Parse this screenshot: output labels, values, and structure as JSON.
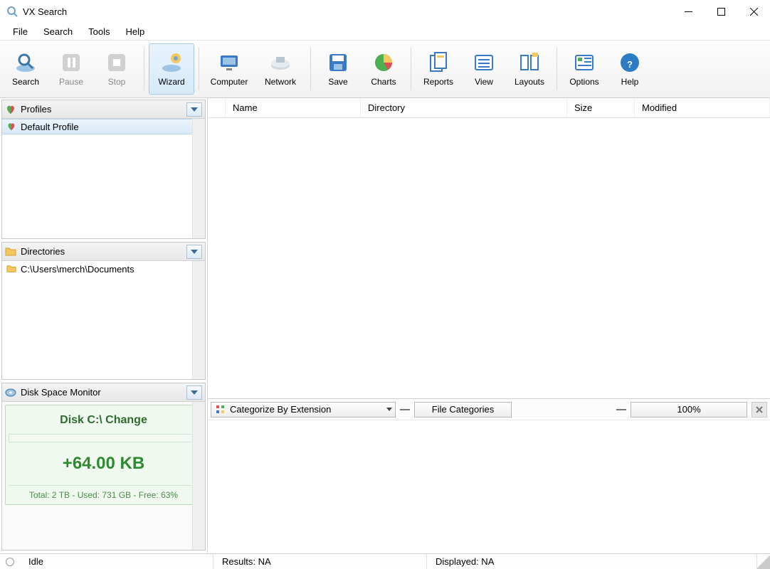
{
  "title": "VX Search",
  "menu": {
    "file": "File",
    "search": "Search",
    "tools": "Tools",
    "help": "Help"
  },
  "toolbar": {
    "search": "Search",
    "pause": "Pause",
    "stop": "Stop",
    "wizard": "Wizard",
    "computer": "Computer",
    "network": "Network",
    "save": "Save",
    "charts": "Charts",
    "reports": "Reports",
    "view": "View",
    "layouts": "Layouts",
    "options": "Options",
    "help": "Help"
  },
  "sidebar": {
    "profiles": {
      "header": "Profiles",
      "items": [
        "Default Profile"
      ],
      "selected": 0
    },
    "directories": {
      "header": "Directories",
      "items": [
        "C:\\Users\\merch\\Documents"
      ]
    },
    "dsm": {
      "header": "Disk Space Monitor",
      "title": "Disk C:\\ Change",
      "delta": "+64.00 KB",
      "totals": "Total: 2 TB - Used: 731 GB - Free: 63%"
    }
  },
  "grid": {
    "columns": {
      "name": "Name",
      "directory": "Directory",
      "size": "Size",
      "modified": "Modified"
    }
  },
  "catbar": {
    "dropdown": "Categorize By Extension",
    "fileCategories": "File Categories",
    "zoom": "100%"
  },
  "status": {
    "state": "Idle",
    "results": "Results: NA",
    "displayed": "Displayed: NA"
  }
}
